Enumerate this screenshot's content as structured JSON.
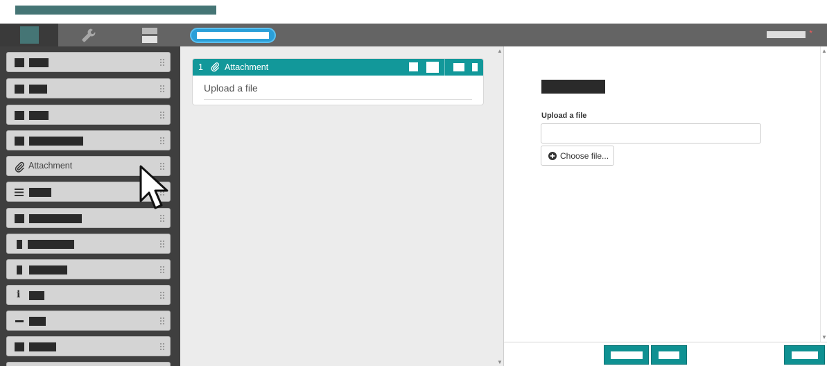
{
  "header": {
    "title_redacted": true
  },
  "toolbar": {
    "tabs": [
      {
        "icon": "square-tab-icon",
        "active": true
      },
      {
        "icon": "wrench-icon",
        "active": false
      },
      {
        "icon": "form-icon",
        "active": false
      }
    ],
    "pill_redacted": true,
    "user_redacted": true,
    "required_marker": "*"
  },
  "palette": {
    "items": [
      {
        "icon": "redacted-icon",
        "label": null
      },
      {
        "icon": "redacted-icon",
        "label": null
      },
      {
        "icon": "redacted-icon",
        "label": null
      },
      {
        "icon": "redacted-icon",
        "label": null
      },
      {
        "icon": "paperclip-icon",
        "label": "Attachment"
      },
      {
        "icon": "lines-icon",
        "label": null
      },
      {
        "icon": "redacted-icon",
        "label": null
      },
      {
        "icon": "bar-icon",
        "label": null
      },
      {
        "icon": "bar-icon",
        "label": null
      },
      {
        "icon": "info-icon",
        "label": null
      },
      {
        "icon": "dash-icon",
        "label": null
      },
      {
        "icon": "redacted-icon",
        "label": null
      }
    ]
  },
  "canvas": {
    "field": {
      "number": "1",
      "title": "Attachment",
      "body": "Upload a file"
    }
  },
  "properties": {
    "heading_redacted": true,
    "label": "Upload a file",
    "input_value": "",
    "choose_button": "Choose file..."
  },
  "colors": {
    "accent": "#12989a",
    "toolbar": "#646464",
    "sidebar": "#3f3f3f",
    "title_bar": "#457575",
    "pill": "#2a9fd8",
    "canvas": "#ececec"
  }
}
